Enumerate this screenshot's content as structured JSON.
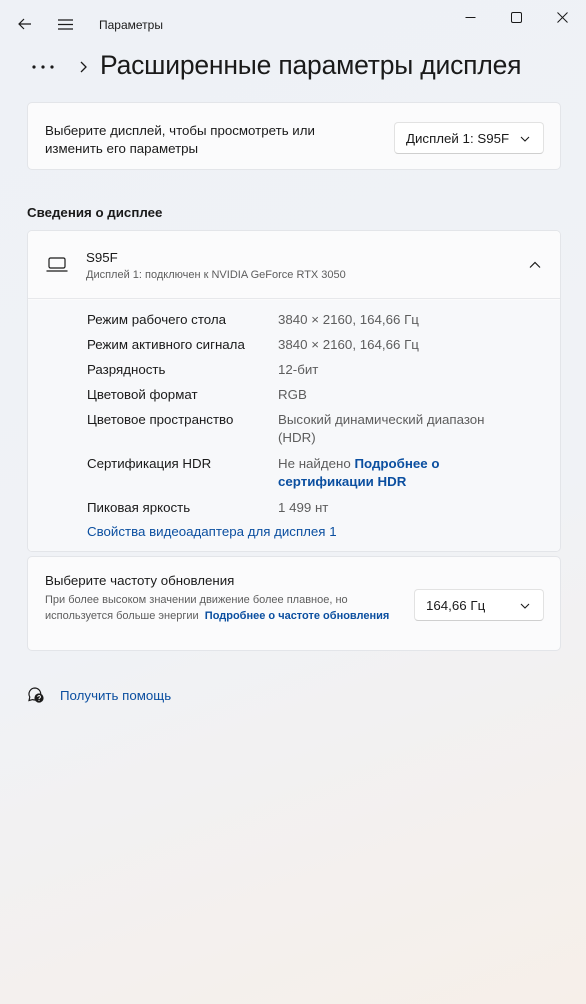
{
  "window": {
    "title": "Параметры",
    "icons": {
      "back": "back-arrow-icon",
      "menu": "hamburger-menu-icon",
      "minimize": "minimize-icon",
      "maximize": "maximize-icon",
      "close": "close-icon"
    }
  },
  "breadcrumb": {
    "more_icon": "more-dots-icon",
    "separator_icon": "chevron-right-icon",
    "title": "Расширенные параметры дисплея"
  },
  "display_select": {
    "label": "Выберите дисплей, чтобы просмотреть или изменить его параметры",
    "selected": "Дисплей 1: S95F"
  },
  "info_section": {
    "heading": "Сведения о дисплее",
    "monitor_name": "S95F",
    "monitor_sub": "Дисплей 1: подключен к NVIDIA GeForce RTX 3050",
    "properties": [
      {
        "label": "Режим рабочего стола",
        "value": "3840 × 2160, 164,66 Гц"
      },
      {
        "label": "Режим активного сигнала",
        "value": "3840 × 2160, 164,66 Гц"
      },
      {
        "label": "Разрядность",
        "value": "12-бит"
      },
      {
        "label": "Цветовой формат",
        "value": "RGB"
      },
      {
        "label": "Цветовое пространство",
        "value": "Высокий динамический диапазон (HDR)"
      },
      {
        "label": "Сертификация HDR",
        "value": "Не найдено",
        "link": "Подробнее о сертификации HDR"
      },
      {
        "label": "Пиковая яркость",
        "value": "1 499 нт"
      }
    ],
    "adapter_link": "Свойства видеоадаптера для дисплея 1"
  },
  "refresh": {
    "title": "Выберите частоту обновления",
    "description": "При более высоком значении движение более плавное, но используется больше энергии",
    "link": "Подробнее о частоте обновления",
    "selected": "164,66 Гц"
  },
  "help": {
    "label": "Получить помощь"
  },
  "colors": {
    "accent": "#0b4fa0",
    "card_bg": "#fbfbfc",
    "text": "#1a1a1a",
    "secondary_text": "#5d5d5d"
  }
}
